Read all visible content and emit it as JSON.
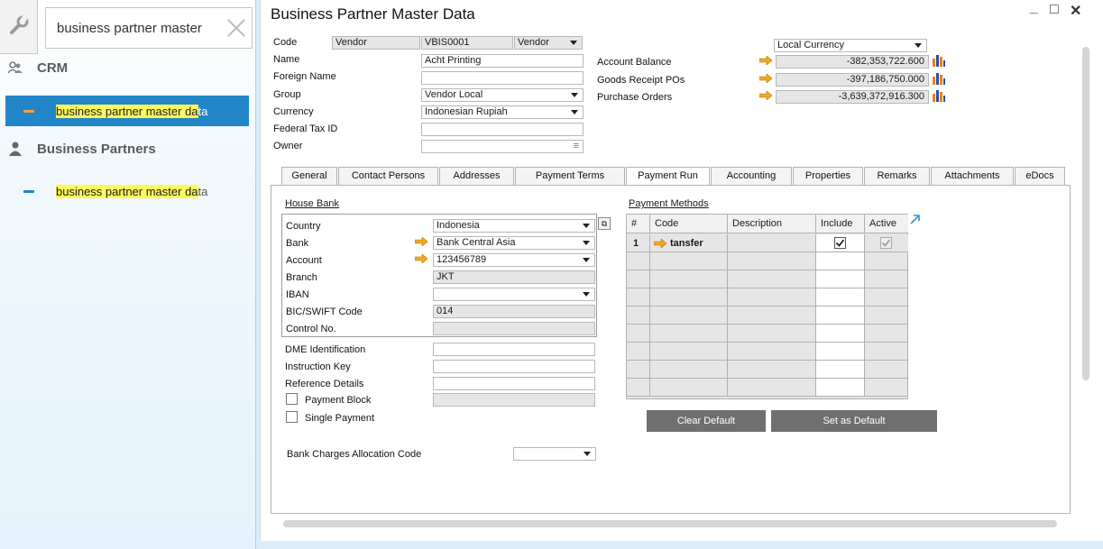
{
  "left_pane": {
    "search_value": "business partner master",
    "groups": [
      {
        "name": "CRM",
        "icon": "people-icon"
      },
      {
        "name": "Business Partners",
        "icon": "person-icon"
      }
    ],
    "results": [
      {
        "highlight": "business partner master da",
        "rest": "ta",
        "selected": true
      },
      {
        "highlight": "business partner master da",
        "rest": "ta",
        "selected": false
      }
    ]
  },
  "window": {
    "title": "Business Partner Master Data",
    "controls": {
      "minimize": "_",
      "maximize": "□",
      "close": "✕"
    }
  },
  "header": {
    "code_label": "Code",
    "code_type": "Vendor",
    "code_value": "VBIS0001",
    "code_type2": "Vendor",
    "name_label": "Name",
    "name_value": "Acht Printing",
    "foreign_name_label": "Foreign Name",
    "foreign_name_value": "",
    "group_label": "Group",
    "group_value": "Vendor Local",
    "currency_label": "Currency",
    "currency_value": "Indonesian Rupiah",
    "federal_tax_label": "Federal Tax ID",
    "federal_tax_value": "",
    "owner_label": "Owner",
    "owner_value": "",
    "currency_view": "Local Currency",
    "account_balance_label": "Account Balance",
    "account_balance_value": "-382,353,722.600",
    "goods_receipt_label": "Goods Receipt POs",
    "goods_receipt_value": "-397,186,750.000",
    "purchase_orders_label": "Purchase Orders",
    "purchase_orders_value": "-3,639,372,916.300"
  },
  "tabs": [
    {
      "label": "General"
    },
    {
      "label": "Contact Persons"
    },
    {
      "label": "Addresses"
    },
    {
      "label": "Payment Terms"
    },
    {
      "label": "Payment Run"
    },
    {
      "label": "Accounting"
    },
    {
      "label": "Properties"
    },
    {
      "label": "Remarks"
    },
    {
      "label": "Attachments"
    },
    {
      "label": "eDocs"
    }
  ],
  "active_tab": "Payment Run",
  "payment_run": {
    "house_bank_title": "House Bank",
    "country_label": "Country",
    "country_value": "Indonesia",
    "bank_label": "Bank",
    "bank_value": "Bank Central Asia",
    "account_label": "Account",
    "account_value": "123456789",
    "branch_label": "Branch",
    "branch_value": "JKT",
    "iban_label": "IBAN",
    "iban_value": "",
    "bic_label": "BIC/SWIFT Code",
    "bic_value": "014",
    "control_label": "Control No.",
    "control_value": "",
    "dme_label": "DME Identification",
    "instruction_label": "Instruction Key",
    "reference_label": "Reference Details",
    "payment_block_label": "Payment Block",
    "payment_block_checked": false,
    "single_payment_label": "Single Payment",
    "single_payment_checked": false,
    "bank_charges_label": "Bank Charges Allocation Code",
    "bank_charges_value": ""
  },
  "payment_methods": {
    "title": "Payment Methods",
    "columns": [
      "#",
      "Code",
      "Description",
      "Include",
      "Active"
    ],
    "rows": [
      {
        "num": "1",
        "code": "tansfer",
        "description": "",
        "include": true,
        "active": true
      }
    ],
    "clear_default_label": "Clear Default",
    "set_default_label": "Set as Default"
  },
  "colors": {
    "selection_blue": "#2386c8",
    "highlight_yellow": "#fff85c",
    "link_arrow_orange": "#f5a623",
    "button_gray": "#6f6f6f"
  }
}
